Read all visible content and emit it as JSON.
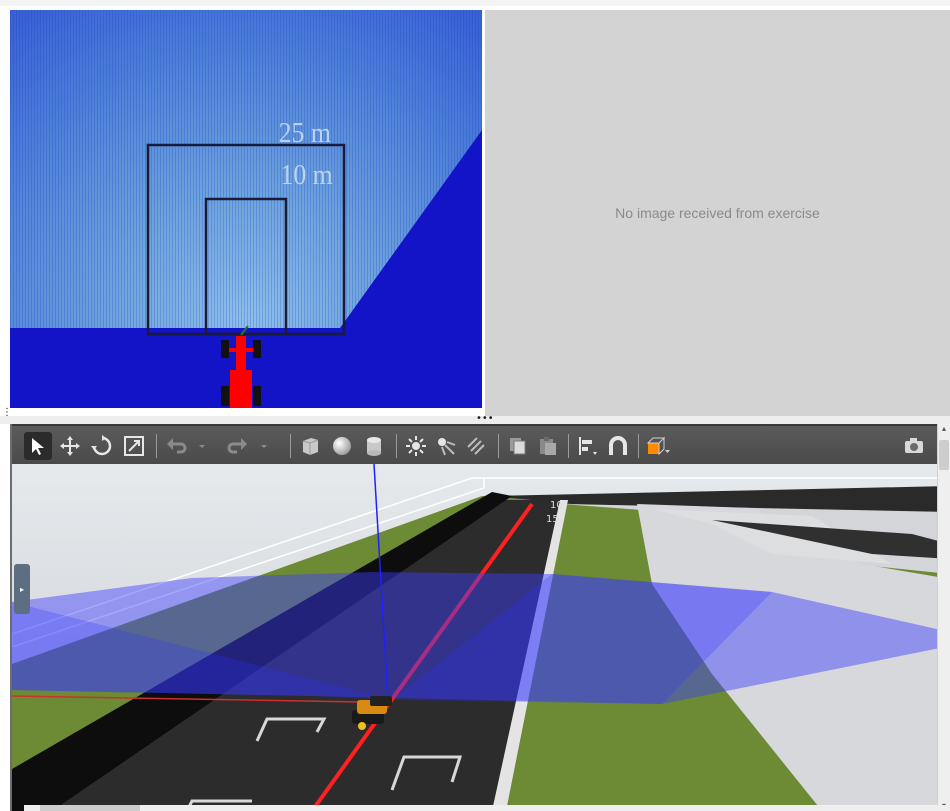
{
  "laser_view": {
    "range_labels": [
      "25 m",
      "10 m"
    ],
    "colors": {
      "background": "#1313c8",
      "scan": "#6aa6df",
      "car": "#ff0000"
    }
  },
  "camera_view": {
    "placeholder_text": "No image received from exercise",
    "background_color": "#d3d3d3"
  },
  "simulator": {
    "toolbar": [
      {
        "name": "select-mode-icon",
        "active": true
      },
      {
        "name": "translate-mode-icon",
        "active": false
      },
      {
        "name": "rotate-mode-icon",
        "active": false
      },
      {
        "name": "scale-mode-icon",
        "active": false
      },
      {
        "name": "undo-icon",
        "active": false
      },
      {
        "name": "undo-dropdown-icon",
        "active": false
      },
      {
        "name": "redo-icon",
        "active": false
      },
      {
        "name": "redo-dropdown-icon",
        "active": false
      },
      {
        "name": "box-shape-icon",
        "active": false
      },
      {
        "name": "sphere-shape-icon",
        "active": false
      },
      {
        "name": "cylinder-shape-icon",
        "active": false
      },
      {
        "name": "point-light-icon",
        "active": false
      },
      {
        "name": "spot-light-icon",
        "active": false
      },
      {
        "name": "directional-light-icon",
        "active": false
      },
      {
        "name": "copy-icon",
        "active": false
      },
      {
        "name": "paste-icon",
        "active": false
      },
      {
        "name": "align-icon",
        "active": false
      },
      {
        "name": "snap-icon",
        "active": false
      },
      {
        "name": "view-angle-icon",
        "active": false
      },
      {
        "name": "screenshot-icon",
        "active": false
      }
    ],
    "track_markers": [
      "10",
      "15"
    ],
    "colors": {
      "grass": "#6d8b35",
      "track": "#2a2a2a",
      "scan_beam": "#3b3bff",
      "sky": "#d5d9de"
    }
  }
}
